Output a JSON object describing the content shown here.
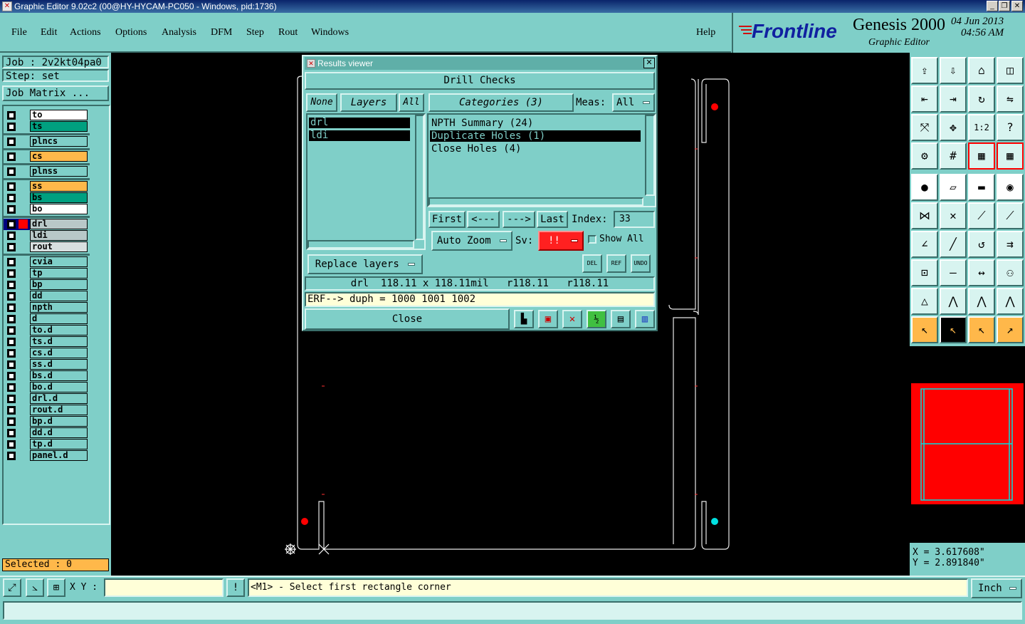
{
  "window": {
    "title": "Graphic Editor 9.02c2 (00@HY-HYCAM-PC050 - Windows, pid:1736)"
  },
  "menu": {
    "items": [
      "File",
      "Edit",
      "Actions",
      "Options",
      "Analysis",
      "DFM",
      "Step",
      "Rout",
      "Windows"
    ],
    "help": "Help"
  },
  "brand": {
    "logo": "Frontline",
    "product": "Genesis 2000",
    "subtitle": "Graphic Editor",
    "date": "04 Jun 2013",
    "time": "04:56 AM"
  },
  "left": {
    "job": "Job : 2v2kt04pa0",
    "step": "Step: set",
    "job_matrix": "Job Matrix ...",
    "selected": "Selected : 0"
  },
  "layers": [
    {
      "name": "to",
      "color": "#ffffff"
    },
    {
      "name": "ts",
      "color": "#00a080"
    },
    {
      "name": "plncs",
      "color": "#7fcfc8"
    },
    {
      "name": "cs",
      "color": "#ffb84a"
    },
    {
      "name": "plnss",
      "color": "#7fcfc8"
    },
    {
      "name": "ss",
      "color": "#ffb84a"
    },
    {
      "name": "bs",
      "color": "#00a080"
    },
    {
      "name": "bo",
      "color": "#ffffff"
    },
    {
      "name": "drl",
      "color": "#b8c8c8"
    },
    {
      "name": "ldi",
      "color": "#b8c8c8"
    },
    {
      "name": "rout",
      "color": "#d8e0e0"
    },
    {
      "name": "cvia",
      "color": "#7fcfc8"
    },
    {
      "name": "tp",
      "color": "#7fcfc8"
    },
    {
      "name": "bp",
      "color": "#7fcfc8"
    },
    {
      "name": "dd",
      "color": "#7fcfc8"
    },
    {
      "name": "npth",
      "color": "#7fcfc8"
    },
    {
      "name": "d",
      "color": "#7fcfc8"
    },
    {
      "name": "to.d",
      "color": "#7fcfc8"
    },
    {
      "name": "ts.d",
      "color": "#7fcfc8"
    },
    {
      "name": "cs.d",
      "color": "#7fcfc8"
    },
    {
      "name": "ss.d",
      "color": "#7fcfc8"
    },
    {
      "name": "bs.d",
      "color": "#7fcfc8"
    },
    {
      "name": "bo.d",
      "color": "#7fcfc8"
    },
    {
      "name": "drl.d",
      "color": "#7fcfc8"
    },
    {
      "name": "rout.d",
      "color": "#7fcfc8"
    },
    {
      "name": "bp.d",
      "color": "#7fcfc8"
    },
    {
      "name": "dd.d",
      "color": "#7fcfc8"
    },
    {
      "name": "tp.d",
      "color": "#7fcfc8"
    },
    {
      "name": "panel.d",
      "color": "#7fcfc8"
    }
  ],
  "results_viewer": {
    "title": "Results viewer",
    "header": "Drill Checks",
    "none_btn": "None",
    "layers_btn": "Layers",
    "all_btn": "All",
    "categories_btn": "Categories (3)",
    "meas_label": "Meas:",
    "meas_value": "All",
    "layer_list": [
      "drl",
      "ldi"
    ],
    "categories": [
      "NPTH Summary (24)",
      "Duplicate Holes (1)",
      "Close Holes (4)"
    ],
    "first_btn": "First",
    "prev_btn": "<---",
    "next_btn": "--->",
    "last_btn": "Last",
    "index_label": "Index:",
    "index_value": "33",
    "auto_zoom": "Auto Zoom",
    "sv_label": "Sv:",
    "sv_value": "!!",
    "show_all": "Show All",
    "replace_layers": "Replace layers",
    "del_btn": "DEL",
    "ref_btn": "REF",
    "undo_btn": "UNDO",
    "measure_line": "drl  118.11 x 118.11mil   r118.11   r118.11",
    "erf_line": "ERF--> duph = 1000 1001 1002",
    "close_btn": "Close"
  },
  "coords": {
    "x": "X = 3.617608\"",
    "y": "Y = 2.891840\""
  },
  "status": {
    "xy_label": "X Y :",
    "xy_value": "",
    "message": "<M1> - Select first rectangle corner",
    "units": "Inch"
  },
  "colors": {
    "panel": "#7fcfc8",
    "canvas": "#000000",
    "highlight_red": "#ff0000",
    "cyan": "#00e0e0"
  }
}
